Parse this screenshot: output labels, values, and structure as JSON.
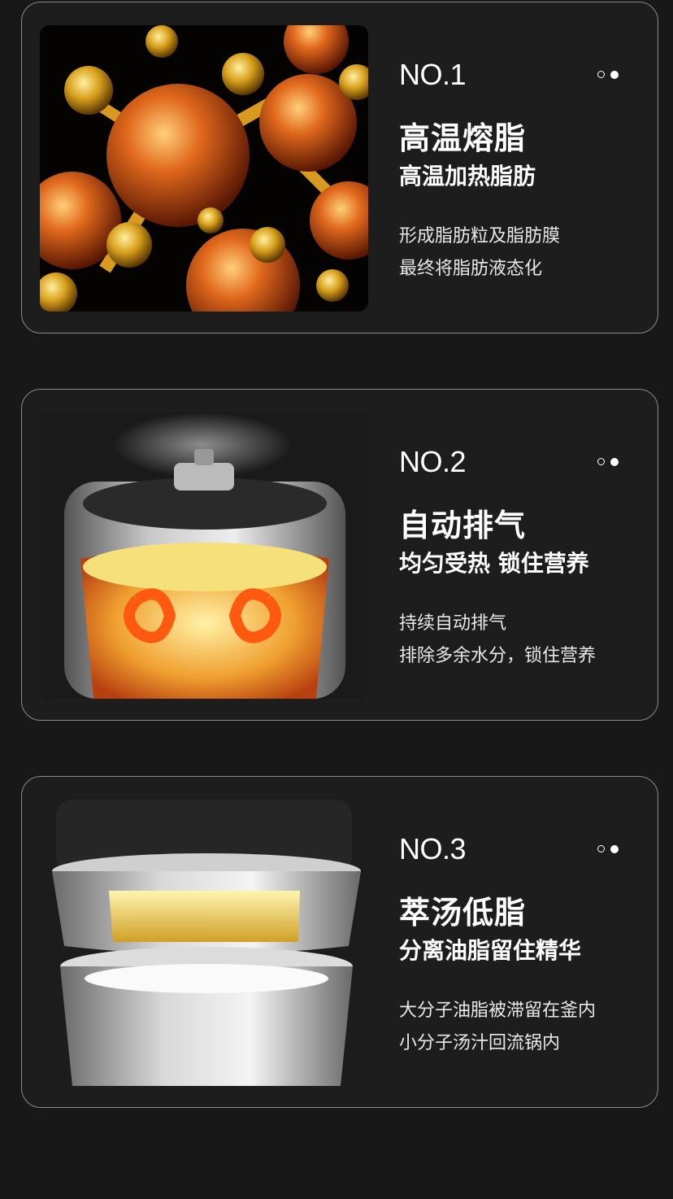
{
  "features": [
    {
      "number": "NO.1",
      "title": "高温熔脂",
      "subtitle": "高温加热脂肪",
      "lines": [
        "形成脂肪粒及脂肪膜",
        "最终将脂肪液态化"
      ],
      "image_desc": "fat-molecules"
    },
    {
      "number": "NO.2",
      "title": "自动排气",
      "subtitle": "均匀受热 锁住营养",
      "lines": [
        "持续自动排气",
        "排除多余水分，锁住营养"
      ],
      "image_desc": "pressure-cooker-steam"
    },
    {
      "number": "NO.3",
      "title": "萃汤低脂",
      "subtitle": "分离油脂留住精华",
      "lines": [
        "大分子油脂被滞留在釜内",
        "小分子汤汁回流锅内"
      ],
      "image_desc": "steel-pots"
    }
  ],
  "colors": {
    "background": "#181818",
    "card_border": "#8a8a8a",
    "text": "#ffffff"
  }
}
